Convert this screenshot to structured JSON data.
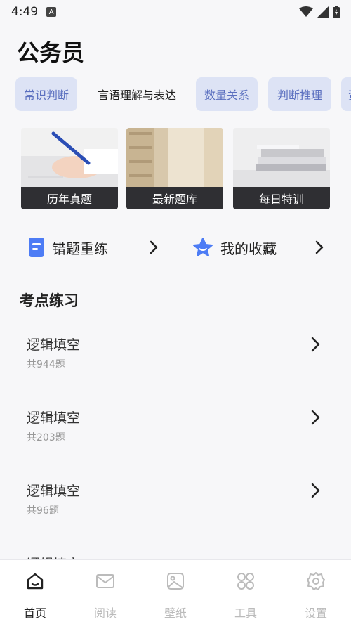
{
  "status": {
    "time": "4:49",
    "a_icon": "A"
  },
  "title": "公务员",
  "tabs": [
    {
      "label": "常识判断",
      "active": false
    },
    {
      "label": "言语理解与表达",
      "active": true
    },
    {
      "label": "数量关系",
      "active": false
    },
    {
      "label": "判断推理",
      "active": false
    },
    {
      "label": "资",
      "active": false
    }
  ],
  "cards": [
    {
      "label": "历年真题",
      "icon": "hand-writing-photo"
    },
    {
      "label": "最新题库",
      "icon": "library-photo"
    },
    {
      "label": "每日特训",
      "icon": "books-photo"
    }
  ],
  "quick": [
    {
      "label": "错题重练",
      "icon": "document-icon"
    },
    {
      "label": "我的收藏",
      "icon": "star-icon"
    }
  ],
  "section_title": "考点练习",
  "practice": [
    {
      "title": "逻辑填空",
      "count": "共944题"
    },
    {
      "title": "逻辑填空",
      "count": "共203题"
    },
    {
      "title": "逻辑填空",
      "count": "共96题"
    },
    {
      "title": "逻辑填空",
      "count": ""
    }
  ],
  "nav": [
    {
      "label": "首页",
      "icon": "home-icon",
      "active": true
    },
    {
      "label": "阅读",
      "icon": "mail-icon",
      "active": false
    },
    {
      "label": "壁纸",
      "icon": "image-icon",
      "active": false
    },
    {
      "label": "工具",
      "icon": "grid-icon",
      "active": false
    },
    {
      "label": "设置",
      "icon": "gear-icon",
      "active": false
    }
  ],
  "colors": {
    "accent": "#5a6fbf",
    "tab_bg": "#dde3f5",
    "card_label_bg": "#2f2f33",
    "icon_blue": "#4d7cf5"
  }
}
